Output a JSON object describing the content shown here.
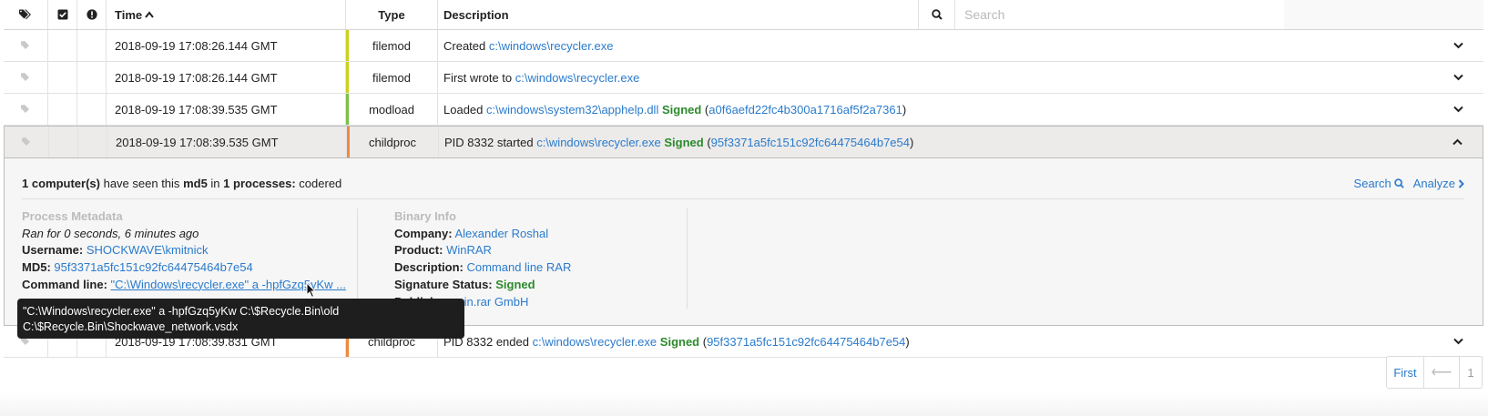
{
  "header": {
    "time_label": "Time",
    "type_label": "Type",
    "description_label": "Description",
    "search_placeholder": "Search"
  },
  "rows": [
    {
      "time": "2018-09-19 17:08:26.144 GMT",
      "type": "filemod",
      "color": "#c8d21e",
      "desc_prefix": "Created",
      "desc_link": "c:\\windows\\recycler.exe"
    },
    {
      "time": "2018-09-19 17:08:26.144 GMT",
      "type": "filemod",
      "color": "#c8d21e",
      "desc_prefix": "First wrote to",
      "desc_link": "c:\\windows\\recycler.exe"
    },
    {
      "time": "2018-09-19 17:08:39.535 GMT",
      "type": "modload",
      "color": "#7bbf4a",
      "desc_prefix": "Loaded",
      "desc_link": "c:\\windows\\system32\\apphelp.dll",
      "signed": "Signed",
      "hash": "a0f6aefd22fc4b300a1716af5f2a7361"
    },
    {
      "time": "2018-09-19 17:08:39.535 GMT",
      "type": "childproc",
      "color": "#f0893a",
      "desc_prefix": "PID 8332 started",
      "desc_link": "c:\\windows\\recycler.exe",
      "signed": "Signed",
      "hash": "95f3371a5fc151c92fc64475464b7e54"
    },
    {
      "time": "2018-09-19 17:08:39.831 GMT",
      "type": "childproc",
      "color": "#f0893a",
      "desc_prefix": "PID 8332 ended",
      "desc_link": "c:\\windows\\recycler.exe",
      "signed": "Signed",
      "hash": "95f3371a5fc151c92fc64475464b7e54"
    }
  ],
  "detail": {
    "summary_count": "1 computer(s)",
    "summary_mid1": "have seen this",
    "summary_md5": "md5",
    "summary_in": "in",
    "summary_procs": "1 processes:",
    "summary_name": "codered",
    "search_label": "Search",
    "analyze_label": "Analyze",
    "process": {
      "title": "Process Metadata",
      "ran_for": "Ran for 0 seconds, 6 minutes ago",
      "username_label": "Username:",
      "username": "SHOCKWAVE\\kmitnick",
      "md5_label": "MD5:",
      "md5": "95f3371a5fc151c92fc64475464b7e54",
      "cmd_label": "Command line:",
      "cmd": "\"C:\\Windows\\recycler.exe\" a -hpfGzq5yKw ..."
    },
    "binary": {
      "title": "Binary Info",
      "company_label": "Company:",
      "company": "Alexander Roshal",
      "product_label": "Product:",
      "product": "WinRAR",
      "description_label": "Description:",
      "description": "Command line RAR",
      "sig_label": "Signature Status:",
      "sig": "Signed",
      "publisher_label": "Publisher:",
      "publisher": "win.rar GmbH"
    }
  },
  "tooltip": {
    "line1": "\"C:\\Windows\\recycler.exe\" a -hpfGzq5yKw C:\\$Recycle.Bin\\old",
    "line2": "C:\\$Recycle.Bin\\Shockwave_network.vsdx"
  },
  "pager": {
    "first": "First",
    "prev": "⟵",
    "page": "1"
  }
}
